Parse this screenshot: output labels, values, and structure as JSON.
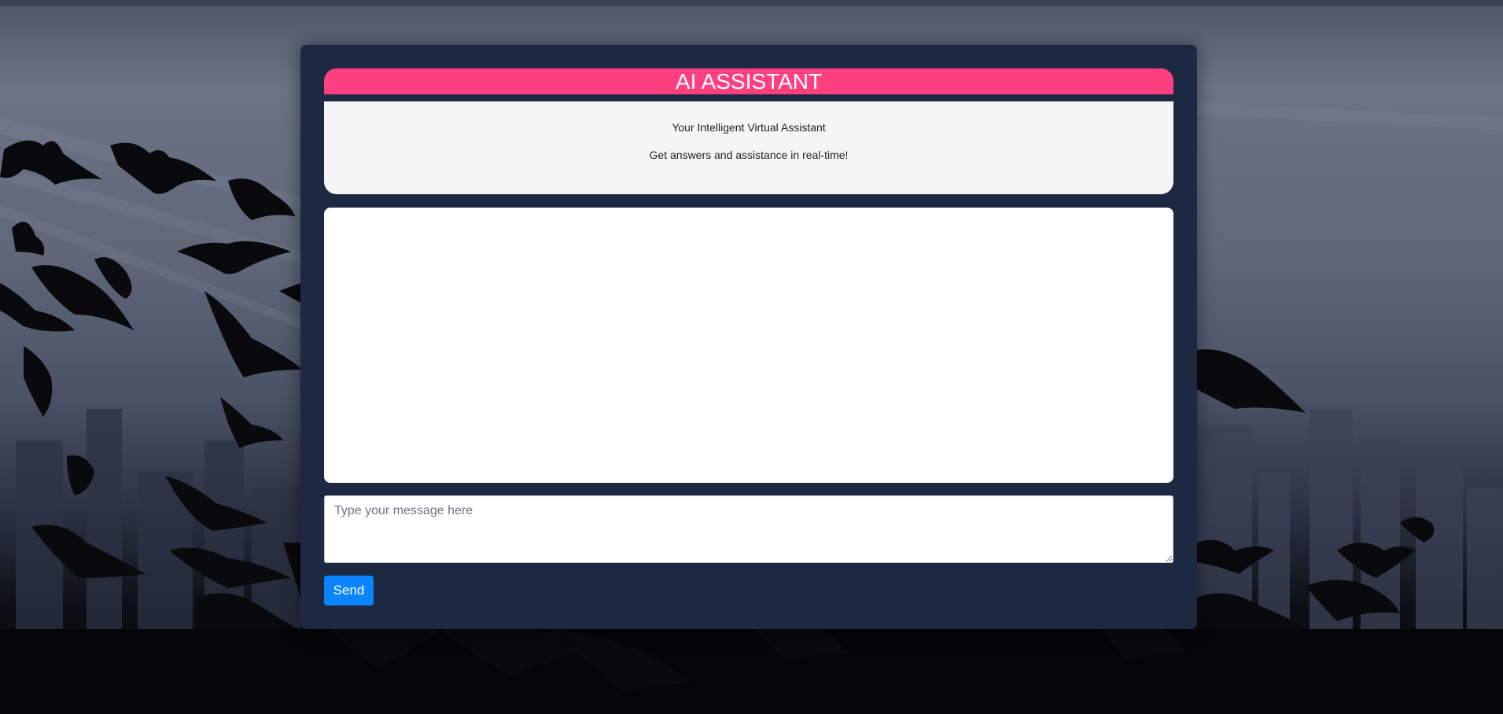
{
  "header": {
    "title": "AI ASSISTANT"
  },
  "intro": {
    "tagline": "Your Intelligent Virtual Assistant",
    "subtitle": "Get answers and assistance in real-time!"
  },
  "chat": {
    "messages": []
  },
  "composer": {
    "placeholder": "Type your message here",
    "value": "",
    "send_label": "Send"
  },
  "colors": {
    "title_bar": "#ff3f7f",
    "panel_bg": "#1d2943",
    "send_button": "#0b84ff",
    "info_bg": "#f5f5f5"
  },
  "background": {
    "scene": "bats-over-city-skyline"
  }
}
